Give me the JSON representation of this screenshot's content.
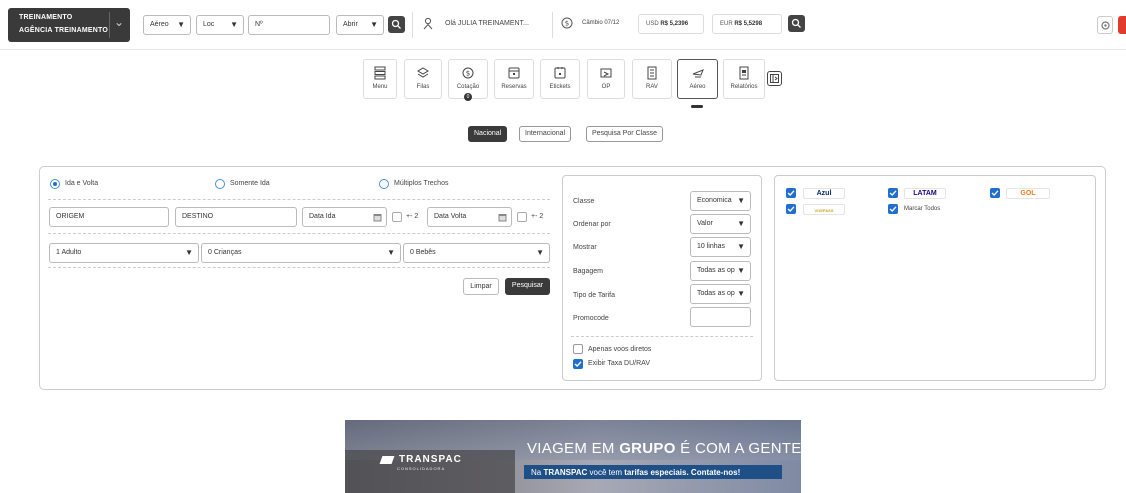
{
  "topbar": {
    "agency_line1": "TREINAMENTO",
    "agency_line2": "AGÊNCIA TREINAMENTO",
    "product_select": "Aéreo",
    "loc_select": "Loc",
    "number_placeholder": "Nº",
    "action_select": "Abrir",
    "greeting": "Olá JULIA TREINAMENT...",
    "exchange_label": "Câmbio 07/12",
    "usd_label": "USD",
    "usd_value": "R$ 5,2396",
    "eur_label": "EUR",
    "eur_value": "R$ 5,5298"
  },
  "modules": [
    {
      "label": "Menu",
      "icon": "menu-icon"
    },
    {
      "label": "Filas",
      "icon": "layers-icon"
    },
    {
      "label": "Cotação",
      "icon": "dollar-icon",
      "badge": "0"
    },
    {
      "label": "Reservas",
      "icon": "calendar-icon"
    },
    {
      "label": "Etickets",
      "icon": "ticket-icon"
    },
    {
      "label": "OP",
      "icon": "op-icon"
    },
    {
      "label": "RAV",
      "icon": "document-icon"
    },
    {
      "label": "Aéreo",
      "icon": "plane-icon",
      "active": true
    },
    {
      "label": "Relatórios",
      "icon": "report-icon"
    }
  ],
  "search_tabs": [
    "Nacional",
    "Internacional",
    "Pesquisa Por Classe"
  ],
  "trip_types": [
    "Ida e Volta",
    "Somente Ida",
    "Múltiplos Trechos"
  ],
  "form": {
    "origin_placeholder": "ORIGEM",
    "destination_placeholder": "DESTINO",
    "date_out_placeholder": "Data Ida",
    "date_back_placeholder": "Data Volta",
    "flex_label_1": "+- 2",
    "flex_label_2": "+- 2",
    "adults": "1 Adulto",
    "children": "0 Crianças",
    "babies": "0 Bebês",
    "clear_label": "Limpar",
    "search_label": "Pesquisar"
  },
  "filters": {
    "class_label": "Classe",
    "class_value": "Economica",
    "order_label": "Ordenar por",
    "order_value": "Valor",
    "show_label": "Mostrar",
    "show_value": "10 linhas",
    "baggage_label": "Bagagem",
    "baggage_value": "Todas as op",
    "fare_label": "Tipo de Tarifa",
    "fare_value": "Todas as op",
    "promo_label": "Promocode",
    "direct_label": "Apenas voos diretos",
    "fee_label": "Exibir Taxa DU/RAV"
  },
  "airlines": {
    "azul": "Azul",
    "latam": "LATAM",
    "gol": "GOL",
    "voepass": "VOEPASS",
    "select_all": "Marcar Todos"
  },
  "banner": {
    "logo": "TRANSPAC",
    "logo_sub": "CONSOLIDADORA",
    "headline_1": "VIAGEM EM ",
    "headline_bold": "GRUPO",
    "headline_2": " É COM A GENTE!",
    "sub_1": "Na ",
    "sub_bold_1": "TRANSPAC",
    "sub_2": " você tem ",
    "sub_bold_2": "tarifas especiais. Contate-nos!"
  },
  "colors": {
    "dark": "#3a3a3a",
    "accent_blue": "#1e6fcf",
    "banner_blue": "#1f4f87",
    "latam_red": "#c8102e",
    "gol_orange": "#f47920",
    "azul_navy": "#0c2a6b"
  }
}
